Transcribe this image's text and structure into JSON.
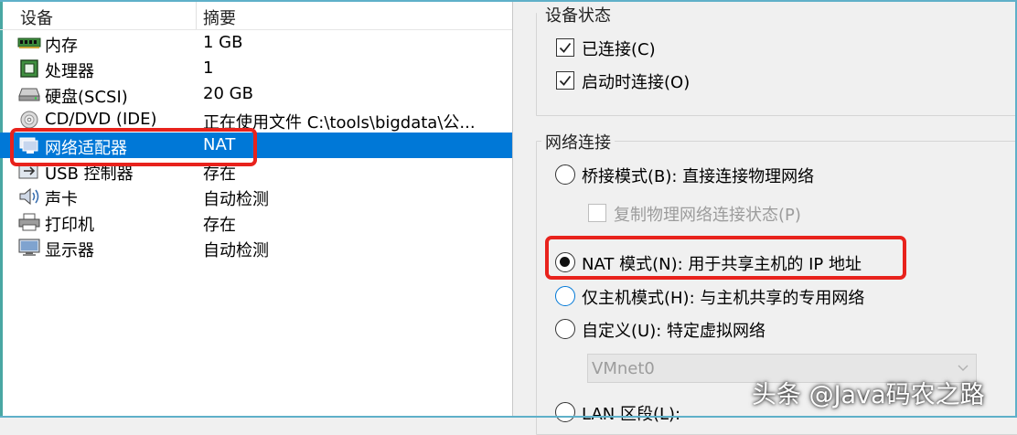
{
  "device_list": {
    "header": {
      "device": "设备",
      "summary": "摘要"
    },
    "rows": [
      {
        "icon": "memory-icon",
        "name": "内存",
        "summary": "1 GB",
        "selected": false
      },
      {
        "icon": "processor-icon",
        "name": "处理器",
        "summary": "1",
        "selected": false
      },
      {
        "icon": "hard-disk-icon",
        "name": "硬盘(SCSI)",
        "summary": "20 GB",
        "selected": false
      },
      {
        "icon": "cd-dvd-icon",
        "name": "CD/DVD (IDE)",
        "summary": "正在使用文件 C:\\tools\\bigdata\\公...",
        "selected": false
      },
      {
        "icon": "network-adapter-icon",
        "name": "网络适配器",
        "summary": "NAT",
        "selected": true
      },
      {
        "icon": "usb-controller-icon",
        "name": "USB 控制器",
        "summary": "存在",
        "selected": false
      },
      {
        "icon": "sound-card-icon",
        "name": "声卡",
        "summary": "自动检测",
        "selected": false
      },
      {
        "icon": "printer-icon",
        "name": "打印机",
        "summary": "存在",
        "selected": false
      },
      {
        "icon": "display-icon",
        "name": "显示器",
        "summary": "自动检测",
        "selected": false
      }
    ]
  },
  "device_status": {
    "title": "设备状态",
    "connected": {
      "label": "已连接(C)",
      "checked": true
    },
    "connect_at_power_on": {
      "label": "启动时连接(O)",
      "checked": true
    }
  },
  "network_connection": {
    "title": "网络连接",
    "bridged": {
      "label": "桥接模式(B): 直接连接物理网络",
      "selected": false
    },
    "replicate_state": {
      "label": "复制物理网络连接状态(P)",
      "checked": false,
      "enabled": false
    },
    "nat": {
      "label": "NAT 模式(N): 用于共享主机的 IP 地址",
      "selected": true
    },
    "host_only": {
      "label": "仅主机模式(H): 与主机共享的专用网络",
      "selected": false
    },
    "custom": {
      "label": "自定义(U): 特定虚拟网络",
      "selected": false
    },
    "custom_network_select": {
      "value": "VMnet0",
      "enabled": false
    },
    "lan_segment": {
      "label": "LAN 区段(L):",
      "selected": false
    }
  },
  "watermark": "头条 @Java码农之路",
  "colors": {
    "selection": "#0078d7",
    "highlight_box": "#e8221c",
    "panel_background": "#f0f0f0"
  }
}
